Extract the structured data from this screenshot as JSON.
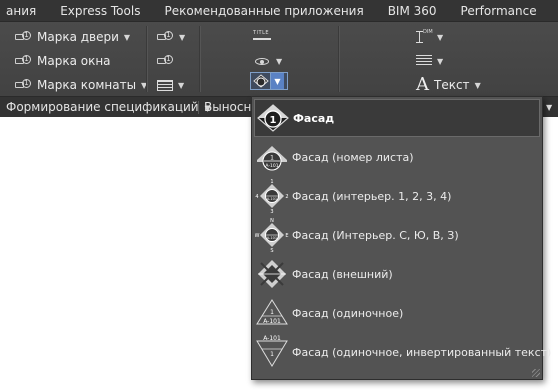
{
  "tabs": [
    "ания",
    "Express Tools",
    "Рекомендованные приложения",
    "BIM 360",
    "Performance"
  ],
  "ribbon": {
    "tag_buttons": [
      {
        "label": "Марка двери",
        "icon": "door-tag-icon"
      },
      {
        "label": "Марка окна",
        "icon": "window-tag-icon"
      },
      {
        "label": "Марка комнаты",
        "icon": "room-tag-icon"
      }
    ],
    "text_label": "Текст"
  },
  "panel_titles": {
    "schedules": "Формирование спецификаций",
    "callouts": "Выносны"
  },
  "elevation_menu": {
    "items": [
      {
        "label": "Фасад",
        "icon": "elevation-icon",
        "active": true
      },
      {
        "label": "Фасад (номер листа)",
        "icon": "elevation-sheet-number-icon",
        "active": false
      },
      {
        "label": "Фасад (интерьер. 1, 2, 3, 4)",
        "icon": "interior-elevation-numeric-icon",
        "active": false
      },
      {
        "label": "Фасад (Интерьер. С, Ю, В, З)",
        "icon": "interior-elevation-compass-icon",
        "active": false
      },
      {
        "label": "Фасад (внешний)",
        "icon": "exterior-elevation-icon",
        "active": false
      },
      {
        "label": "Фасад (одиночное)",
        "icon": "single-elevation-icon",
        "active": false
      },
      {
        "label": "Фасад (одиночное, инвертированный текст)",
        "icon": "single-elevation-inverted-icon",
        "active": false
      }
    ],
    "symbol_text": {
      "num": "1",
      "sheet": "A-101",
      "compass_n": "N",
      "compass_s": "S",
      "compass_w": "W",
      "compass_e": "E",
      "n1": "1",
      "n2": "2",
      "n3": "3",
      "n4": "4"
    }
  },
  "colors": {
    "ribbon_bg": "#464646",
    "tabbar_bg": "#343434",
    "menu_bg": "#535353",
    "menu_active_bg": "#3a3a3a",
    "split_button_accent": "#5a82c4",
    "canvas_bg": "#ffffff"
  }
}
